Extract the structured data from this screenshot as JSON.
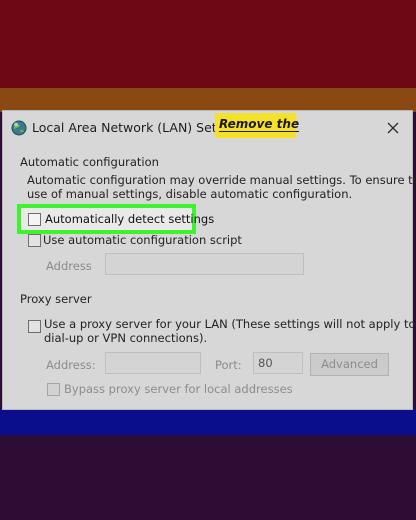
{
  "dialog": {
    "title": "Local Area Network (LAN) Settings",
    "callout": "Remove the",
    "automatic": {
      "heading": "Automatic configuration",
      "description_line1": "Automatic configuration may override manual settings.  To ensure the",
      "description_line2": "use of manual settings, disable automatic configuration.",
      "detect_label": "Automatically detect settings",
      "script_label": "Use automatic configuration script",
      "address_label": "Address"
    },
    "proxy": {
      "heading": "Proxy server",
      "use_proxy_line1": "Use a proxy server for your LAN (These settings will not apply to",
      "use_proxy_line2": "dial-up or VPN connections).",
      "address_label": "Address:",
      "port_label": "Port:",
      "port_value": "80",
      "advanced_label": "Advanced",
      "bypass_label": "Bypass proxy server for local addresses"
    }
  },
  "colors": {
    "highlight_green": "#3ef22f",
    "callout_yellow": "#f6e12a",
    "band_red": "#6d0914",
    "band_blue": "#0a0e8c"
  },
  "icons": {
    "app": "globe-network-icon",
    "close": "close-icon"
  }
}
